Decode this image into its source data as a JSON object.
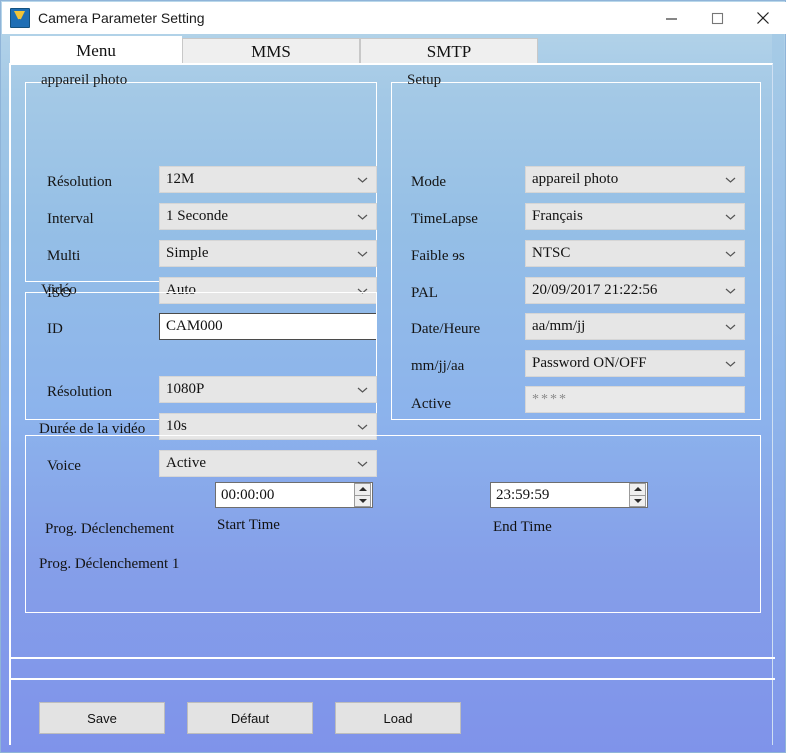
{
  "window": {
    "title": "Camera Parameter Setting",
    "icon": "app-icon",
    "controls": {
      "minimize": "minimize-icon",
      "maximize": "maximize-icon",
      "close": "close-icon"
    }
  },
  "tabs": [
    {
      "label": "Menu",
      "active": true
    },
    {
      "label": "MMS",
      "active": false
    },
    {
      "label": "SMTP",
      "active": false
    }
  ],
  "groups": {
    "photo": {
      "title": "appareil photo",
      "rows": [
        {
          "label": "Résolution",
          "value": "12M",
          "type": "combo"
        },
        {
          "label": "Interval",
          "value": "1 Seconde",
          "type": "combo"
        },
        {
          "label": "Multi",
          "value": "Simple",
          "type": "combo"
        },
        {
          "label": "ISO",
          "value": "Auto",
          "type": "combo"
        },
        {
          "label": "ID",
          "value": "CAM000",
          "type": "text"
        }
      ]
    },
    "video": {
      "title": "Vidéo",
      "rows": [
        {
          "label": "Résolution",
          "value": "1080P",
          "type": "combo"
        },
        {
          "label": "Durée de la vidéo",
          "value": "10s",
          "type": "combo"
        },
        {
          "label": "Voice",
          "value": "Active",
          "type": "combo"
        }
      ]
    },
    "setup": {
      "title": "Setup",
      "rows": [
        {
          "label": "Mode",
          "value": "appareil photo",
          "type": "combo"
        },
        {
          "label": "TimeLapse",
          "value": "Français",
          "type": "combo"
        },
        {
          "label": "Faible ɘs",
          "value": "NTSC",
          "type": "combo"
        },
        {
          "label": "PAL",
          "value": "20/09/2017 21:22:56",
          "type": "combo"
        },
        {
          "label": "Date/Heure",
          "value": "aa/mm/jj",
          "type": "combo"
        },
        {
          "label": "mm/jj/aa",
          "value": "Password ON/OFF",
          "type": "combo"
        },
        {
          "label": "Active",
          "value": "****",
          "type": "password"
        }
      ]
    },
    "schedule": {
      "label": "Prog. Déclenchement",
      "row_label": "Prog. Déclenchement 1",
      "start_header": "Start Time",
      "end_header": "End Time",
      "start_value": "00:00:00",
      "end_value": "23:59:59"
    }
  },
  "footer": {
    "buttons": [
      {
        "label": "Save"
      },
      {
        "label": "Défaut"
      },
      {
        "label": "Load"
      }
    ]
  },
  "colors": {
    "panel_top": "#b9d7ea",
    "panel_bottom": "#7f93ea",
    "combo_bg": "#e6e6e6",
    "button_bg": "#e3e3e3",
    "titlebar_bg": "#ffffff",
    "active_tab_bg": "#ffffff",
    "inactive_tab_bg": "#efefef"
  }
}
